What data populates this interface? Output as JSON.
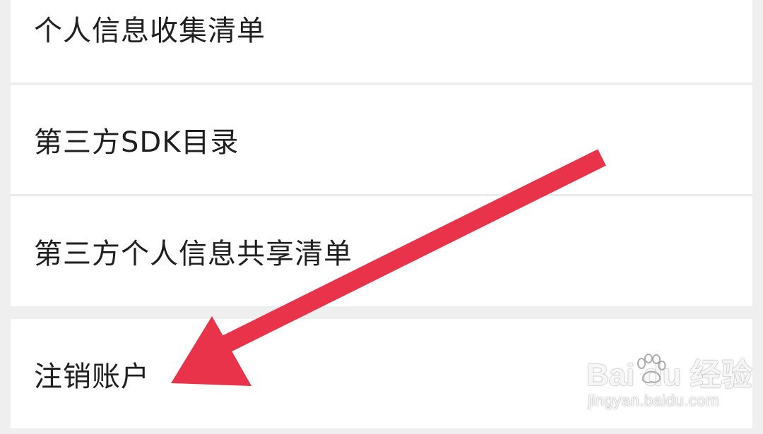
{
  "menu": {
    "group_top": [
      {
        "label": "个人信息收集清单"
      },
      {
        "label": "第三方SDK目录"
      },
      {
        "label": "第三方个人信息共享清单"
      }
    ],
    "group_bottom": [
      {
        "label": "注销账户"
      }
    ]
  },
  "annotation": {
    "arrow_color": "#e8334a",
    "arrow_points_to": "注销账户"
  },
  "watermark": {
    "logo_text": "Bai du 经验",
    "url_text": "jingyan.baidu.com"
  }
}
